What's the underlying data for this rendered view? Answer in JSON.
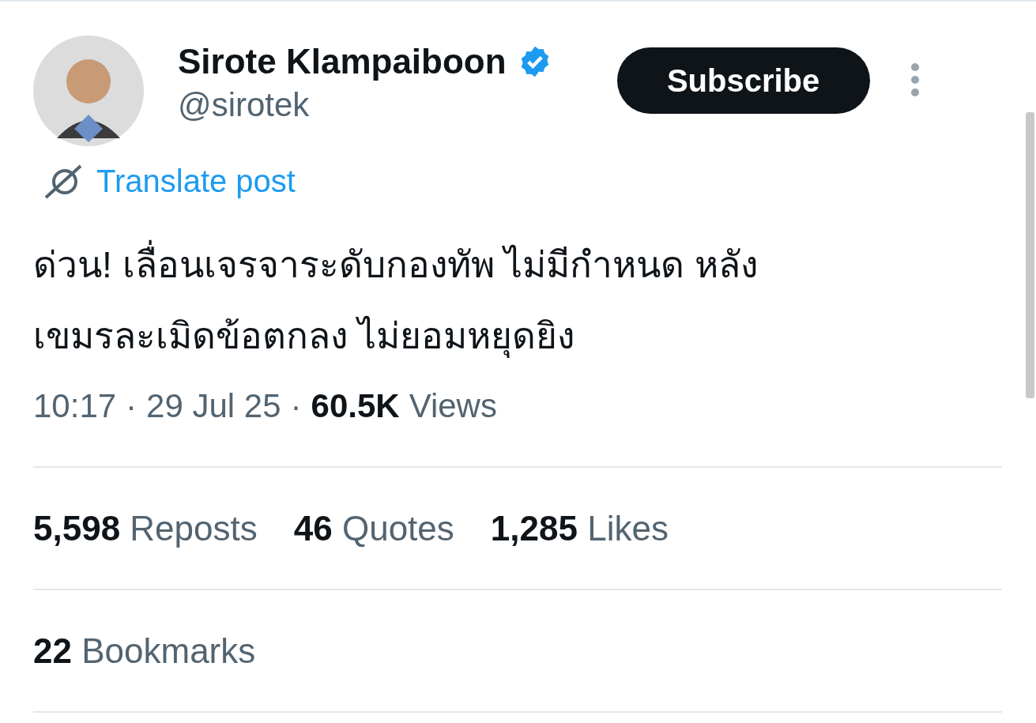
{
  "author": {
    "name": "Sirote Klampaiboon",
    "handle": "@sirotek",
    "verified": true
  },
  "subscribe_button": "Subscribe",
  "translate_link": "Translate post",
  "post_lines": [
    "ด่วน! เลื่อนเจรจาระดับกองทัพ ไม่มีกำหนด หลัง",
    "เขมรละเมิดข้อตกลง ไม่ยอมหยุดยิง"
  ],
  "meta": [
    {
      "kind": "plain",
      "text": "10:17"
    },
    {
      "kind": "sep",
      "text": "·"
    },
    {
      "kind": "plain",
      "text": "29 Jul 25"
    },
    {
      "kind": "sep",
      "text": "·"
    },
    {
      "kind": "bold",
      "text": "60.5K"
    },
    {
      "kind": "plain",
      "text": "Views"
    }
  ],
  "stats": [
    {
      "count": "5,598",
      "label": "Reposts"
    },
    {
      "count": "46",
      "label": "Quotes"
    },
    {
      "count": "1,285",
      "label": "Likes"
    }
  ],
  "bookmarks": {
    "count": "22",
    "label": "Bookmarks"
  }
}
